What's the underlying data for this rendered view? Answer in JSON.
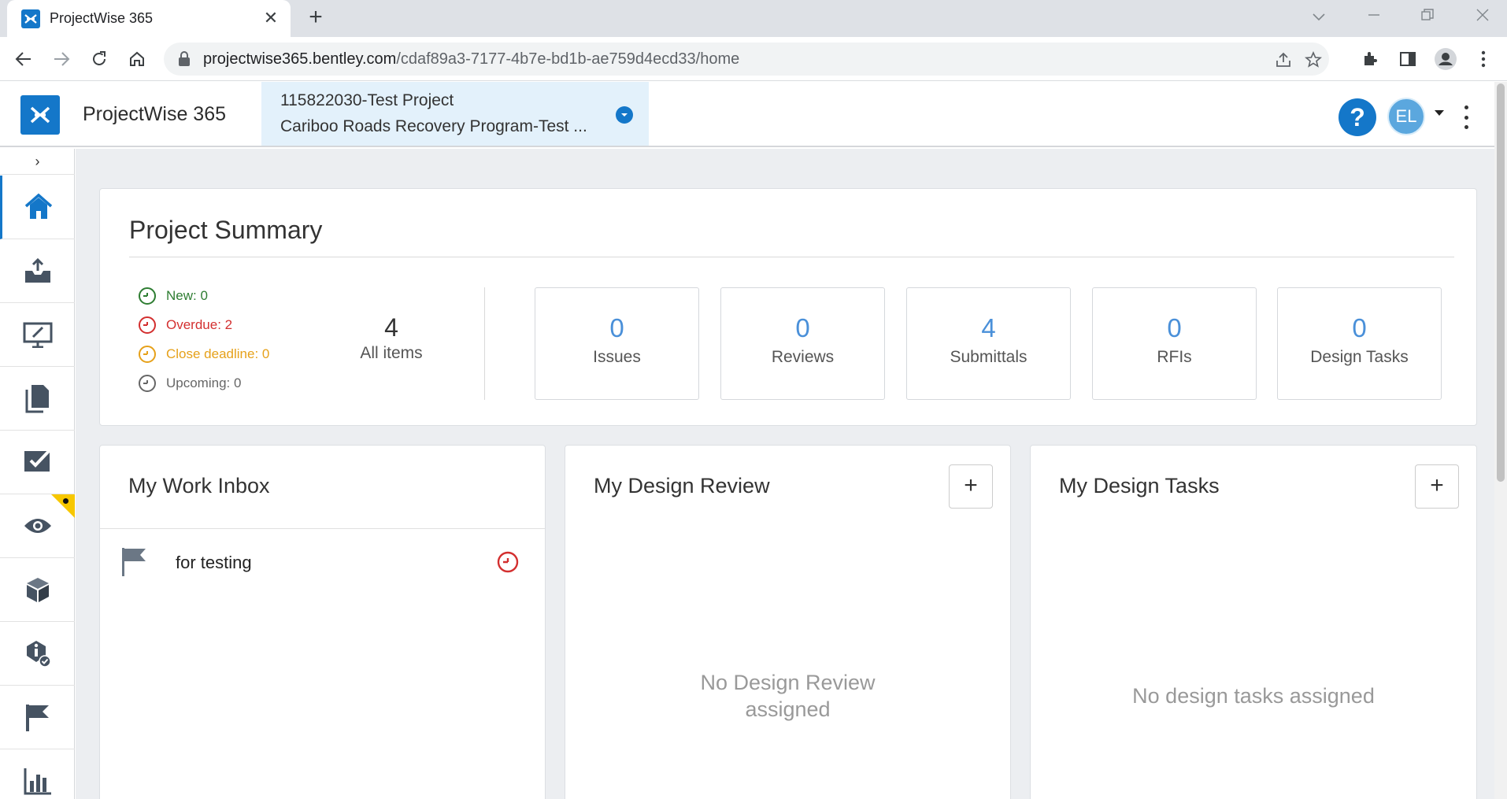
{
  "browser": {
    "tab_title": "ProjectWise 365",
    "url_domain": "projectwise365.bentley.com",
    "url_path": "/cdaf89a3-7177-4b7e-bd1b-ae759d4ecd33/home"
  },
  "header": {
    "app_name": "ProjectWise 365",
    "project_number": "115822030-Test Project",
    "project_name": "Cariboo Roads Recovery Program-Test ...",
    "help_label": "?",
    "user_initials": "EL"
  },
  "sidebar": {
    "toggle": "›",
    "items": [
      {
        "name": "home",
        "icon": "home-icon"
      },
      {
        "name": "inbox",
        "icon": "inbox-upload-icon"
      },
      {
        "name": "design-review",
        "icon": "monitor-edit-icon"
      },
      {
        "name": "documents",
        "icon": "documents-icon"
      },
      {
        "name": "tasks",
        "icon": "checkbox-icon"
      },
      {
        "name": "reviews",
        "icon": "eye-icon"
      },
      {
        "name": "models",
        "icon": "cube-icon"
      },
      {
        "name": "issues",
        "icon": "info-check-icon"
      },
      {
        "name": "flags",
        "icon": "flag-icon"
      },
      {
        "name": "reports",
        "icon": "bar-chart-icon"
      }
    ]
  },
  "summary": {
    "title": "Project Summary",
    "statuses": [
      {
        "label": "New: 0",
        "color": "#2e7d32"
      },
      {
        "label": "Overdue: 2",
        "color": "#d32f2f"
      },
      {
        "label": "Close deadline: 0",
        "color": "#e6a11a"
      },
      {
        "label": "Upcoming: 0",
        "color": "#666666"
      }
    ],
    "all_count": "4",
    "all_label": "All items",
    "stats": [
      {
        "count": "0",
        "label": "Issues"
      },
      {
        "count": "0",
        "label": "Reviews"
      },
      {
        "count": "4",
        "label": "Submittals"
      },
      {
        "count": "0",
        "label": "RFIs"
      },
      {
        "count": "0",
        "label": "Design Tasks"
      }
    ]
  },
  "inbox": {
    "title": "My Work Inbox",
    "items": [
      {
        "label": "for testing",
        "status": "overdue"
      }
    ]
  },
  "design_review": {
    "title": "My Design Review",
    "add_label": "+",
    "empty_line1": "No Design Review",
    "empty_line2": "assigned"
  },
  "design_tasks": {
    "title": "My Design Tasks",
    "add_label": "+",
    "empty": "No design tasks assigned"
  }
}
